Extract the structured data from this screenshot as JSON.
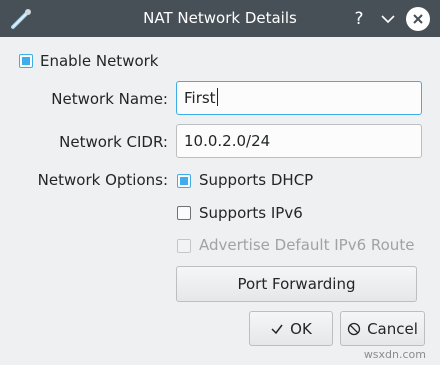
{
  "window": {
    "title": "NAT Network Details",
    "help_glyph": "?"
  },
  "form": {
    "enable_network": {
      "label": "Enable Network",
      "checked": true
    },
    "network_name": {
      "label": "Network Name:",
      "value": "First"
    },
    "network_cidr": {
      "label": "Network CIDR:",
      "value": "10.0.2.0/24"
    },
    "network_options": {
      "label": "Network Options:",
      "supports_dhcp": {
        "label": "Supports DHCP",
        "checked": true
      },
      "supports_ipv6": {
        "label": "Supports IPv6",
        "checked": false
      },
      "advertise_ipv6_route": {
        "label": "Advertise Default IPv6 Route",
        "checked": false,
        "enabled": false
      }
    },
    "port_forwarding_label": "Port Forwarding"
  },
  "footer": {
    "ok_label": "OK",
    "cancel_label": "Cancel"
  },
  "watermark": "wsxdn.com",
  "colors": {
    "titlebar": "#475057",
    "accent": "#3daee9",
    "window_bg": "#eff0f1"
  }
}
